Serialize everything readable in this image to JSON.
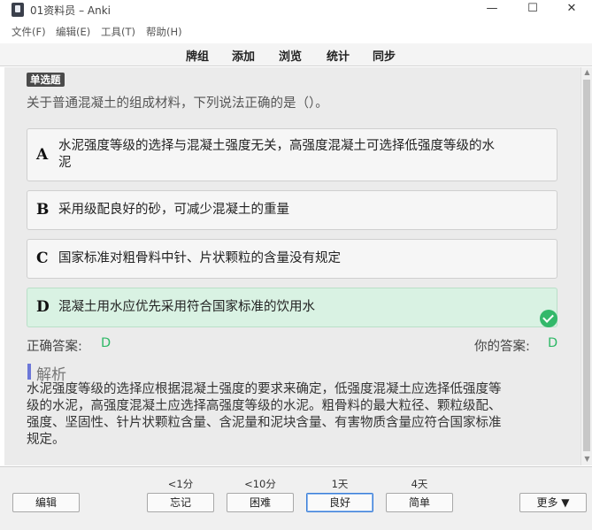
{
  "window": {
    "title": "01资料员 – Anki",
    "controls": {
      "minimize": "—",
      "maximize": "☐",
      "close": "✕"
    }
  },
  "menu": {
    "items": [
      "文件(F)",
      "编辑(E)",
      "工具(T)",
      "帮助(H)"
    ]
  },
  "toolbar": {
    "links": [
      "牌组",
      "添加",
      "浏览",
      "统计",
      "同步"
    ]
  },
  "card": {
    "question_type": "单选题",
    "question": "关于普通混凝土的组成材料，下列说法正确的是（）。",
    "options": [
      {
        "letter": "A",
        "line1": "水泥强度等级的选择与混凝土强度无关，高强度混凝土可选择低强度等级的水",
        "line2": "泥"
      },
      {
        "letter": "B",
        "line1": "采用级配良好的砂，可减少混凝土的重量",
        "line2": ""
      },
      {
        "letter": "C",
        "line1": "国家标准对粗骨料中针、片状颗粒的含量没有规定",
        "line2": ""
      },
      {
        "letter": "D",
        "line1": "混凝土用水应优先采用符合国家标准的饮用水",
        "line2": ""
      }
    ],
    "selected_option": "D",
    "correct_label": "正确答案:",
    "correct_value": "D",
    "your_label": "你的答案:",
    "your_value": "D",
    "explanation_title": "解析",
    "explanation_lines": [
      "水泥强度等级的选择应根据混凝土强度的要求来确定，低强度混凝土应选择低强度等",
      "级的水泥，高强度混凝土应选择高强度等级的水泥。粗骨料的最大粒径、颗粒级配、",
      "强度、坚固性、针片状颗粒含量、含泥量和泥块含量、有害物质含量应符合国家标准",
      "规定。"
    ],
    "colors": {
      "correct_bg": "#d9f2e3",
      "accent_green": "#2db866",
      "explanation_bar": "#6c77d8"
    }
  },
  "bottombar": {
    "edit_label": "编辑",
    "more_label": "更多 ▼",
    "answers": [
      {
        "interval": "<1分",
        "label": "忘记"
      },
      {
        "interval": "<10分",
        "label": "困难"
      },
      {
        "interval": "1天",
        "label": "良好"
      },
      {
        "interval": "4天",
        "label": "简单"
      }
    ],
    "default_answer": "良好"
  }
}
